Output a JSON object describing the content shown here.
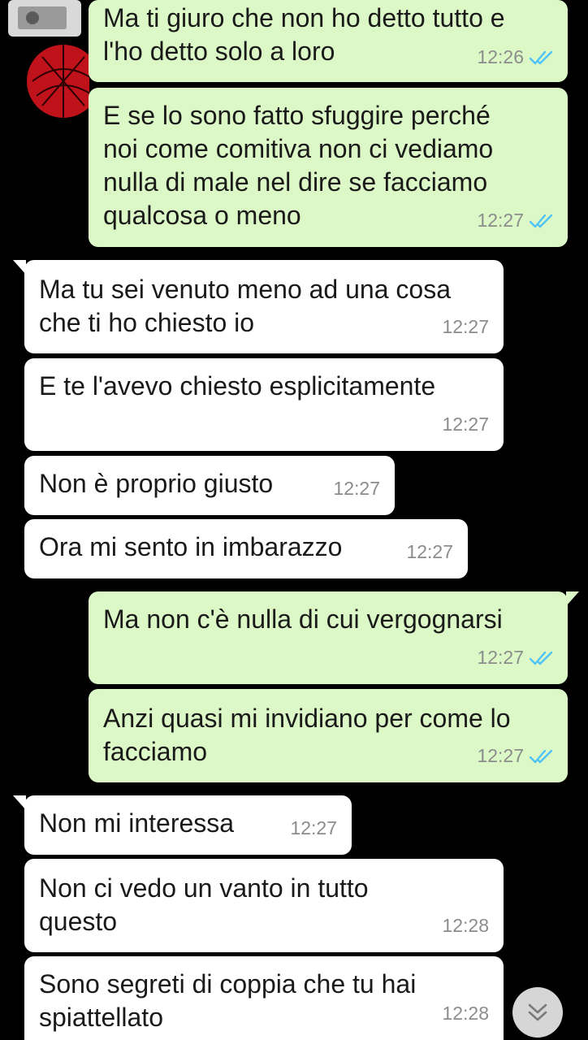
{
  "chat": {
    "messages": [
      {
        "direction": "out",
        "text": "Ma ti giuro che non ho detto tutto e\nl'ho detto solo a loro",
        "time": "12:26",
        "status_icon": "double-check-read-icon"
      },
      {
        "direction": "out",
        "text": "E se lo sono fatto sfuggire perché\nnoi come comitiva non ci vediamo\nnulla di male nel dire se facciamo\nqualcosa o meno",
        "time": "12:27",
        "status_icon": "double-check-read-icon"
      },
      {
        "direction": "in",
        "text": "Ma tu sei venuto meno ad una cosa\nche ti ho chiesto io",
        "time": "12:27"
      },
      {
        "direction": "in",
        "text": "E te l'avevo chiesto esplicitamente",
        "time": "12:27"
      },
      {
        "direction": "in",
        "text": "Non è proprio giusto",
        "time": "12:27"
      },
      {
        "direction": "in",
        "text": "Ora mi sento in imbarazzo",
        "time": "12:27"
      },
      {
        "direction": "out",
        "text": "Ma non c'è nulla di cui vergognarsi",
        "time": "12:27",
        "status_icon": "double-check-read-icon"
      },
      {
        "direction": "out",
        "text": "Anzi quasi mi invidiano per come lo\nfacciamo",
        "time": "12:27",
        "status_icon": "double-check-read-icon"
      },
      {
        "direction": "in",
        "text": "Non mi interessa",
        "time": "12:27"
      },
      {
        "direction": "in",
        "text": "Non ci vedo un vanto in tutto\nquesto",
        "time": "12:28"
      },
      {
        "direction": "in",
        "text": "Sono segreti di coppia che tu hai\nspiattellato",
        "time": "12:28"
      }
    ],
    "scroll_button_icon": "chevron-double-down-icon",
    "colors": {
      "outgoing_bubble": "#dcf8c6",
      "incoming_bubble": "#ffffff",
      "read_ticks": "#4fc3f7",
      "background": "#000000"
    }
  }
}
